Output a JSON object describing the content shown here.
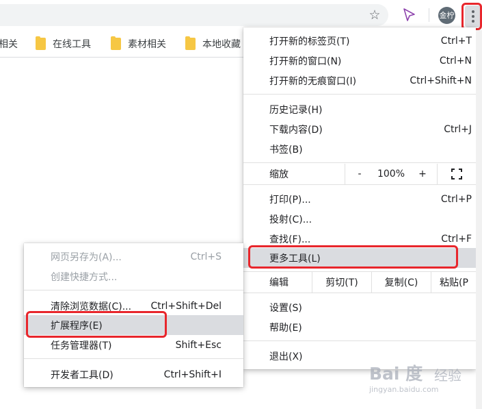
{
  "toolbar": {
    "star_icon": "star-outline-icon",
    "extension_icon": "cursor-arrow-icon",
    "avatar_text": "金柠",
    "menu_icon": "three-dots-vertical-icon"
  },
  "bookmarks": [
    {
      "label": "相关",
      "icon": "folder-icon"
    },
    {
      "label": "在线工具",
      "icon": "folder-icon"
    },
    {
      "label": "素材相关",
      "icon": "folder-icon"
    },
    {
      "label": "本地收藏",
      "icon": "folder-icon"
    }
  ],
  "main_menu": {
    "new_tab": {
      "label": "打开新的标签页(T)",
      "shortcut": "Ctrl+T"
    },
    "new_window": {
      "label": "打开新的窗口(N)",
      "shortcut": "Ctrl+N"
    },
    "new_incognito": {
      "label": "打开新的无痕窗口(I)",
      "shortcut": "Ctrl+Shift+N"
    },
    "history": {
      "label": "历史记录(H)"
    },
    "downloads": {
      "label": "下载内容(D)",
      "shortcut": "Ctrl+J"
    },
    "bookmarks": {
      "label": "书签(B)"
    },
    "zoom": {
      "label": "缩放",
      "minus": "-",
      "value": "100%",
      "plus": "+",
      "fullscreen_icon": "fullscreen-icon"
    },
    "print": {
      "label": "打印(P)...",
      "shortcut": "Ctrl+P"
    },
    "cast": {
      "label": "投射(C)..."
    },
    "find": {
      "label": "查找(F)...",
      "shortcut": "Ctrl+F"
    },
    "more_tools": {
      "label": "更多工具(L)"
    },
    "edit": {
      "label": "编辑",
      "cut": "剪切(T)",
      "copy": "复制(C)",
      "paste": "粘贴(P"
    },
    "settings": {
      "label": "设置(S)"
    },
    "help": {
      "label": "帮助(E)"
    },
    "exit": {
      "label": "退出(X)"
    }
  },
  "submenu": {
    "save_page": {
      "label": "网页另存为(A)...",
      "shortcut": "Ctrl+S"
    },
    "create_shortcut": {
      "label": "创建快捷方式..."
    },
    "clear_data": {
      "label": "清除浏览数据(C)...",
      "shortcut": "Ctrl+Shift+Del"
    },
    "extensions": {
      "label": "扩展程序(E)"
    },
    "task_manager": {
      "label": "任务管理器(T)",
      "shortcut": "Shift+Esc"
    },
    "dev_tools": {
      "label": "开发者工具(D)",
      "shortcut": "Ctrl+Shift+I"
    }
  },
  "watermark": {
    "logo": "Bai 度",
    "brand": "经验",
    "url": "jingyan.baidu.com"
  },
  "colors": {
    "highlight_box": "#e8262c",
    "menu_hover": "#dadce0",
    "folder": "#f6c744"
  }
}
